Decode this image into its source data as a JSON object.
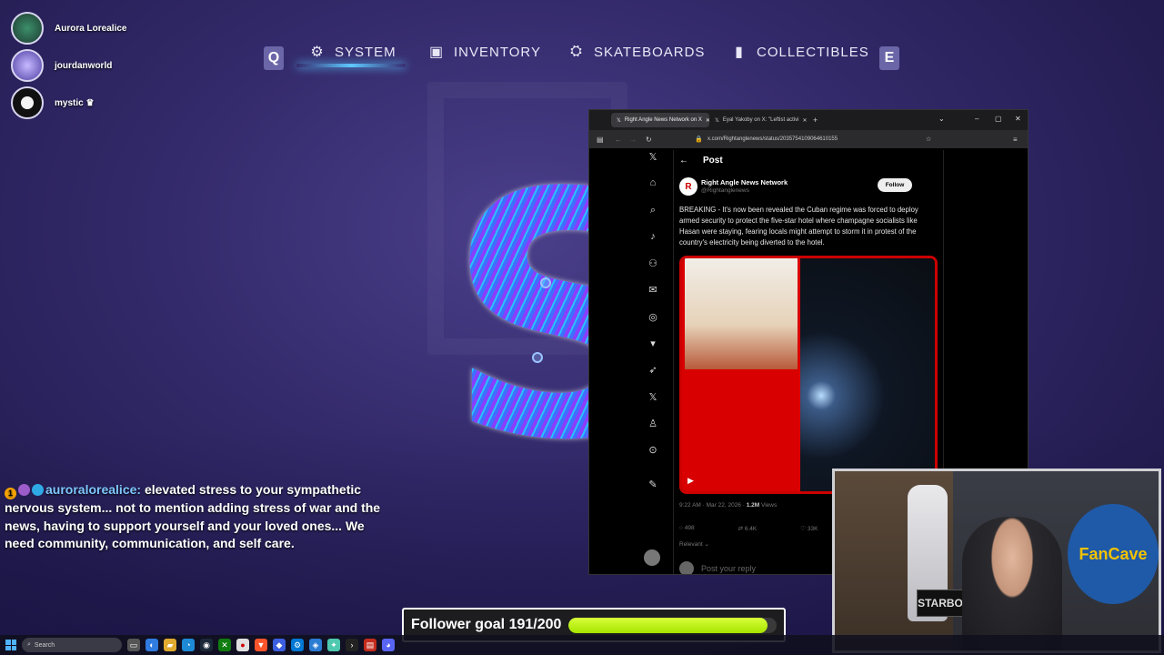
{
  "viewers": [
    {
      "name": "Aurora Lorealice"
    },
    {
      "name": "jourdanworld"
    },
    {
      "name": "mystic ♛"
    }
  ],
  "game_menu": {
    "left_key": "Q",
    "right_key": "E",
    "tabs": [
      {
        "label": "SYSTEM",
        "icon": "gear-icon",
        "active": true
      },
      {
        "label": "INVENTORY",
        "icon": "backpack-icon"
      },
      {
        "label": "SKATEBOARDS",
        "icon": "skateboard-icon"
      },
      {
        "label": "COLLECTIBLES",
        "icon": "card-icon"
      }
    ],
    "big_letter": "S"
  },
  "chat": {
    "username": "auroralorealice:",
    "message": "elevated stress to your sympathetic nervous system... not to mention adding stress of war and the news, having to support yourself and your loved ones... We need community, communication, and self care."
  },
  "browser": {
    "tabs": [
      {
        "title": "Right Angle News Network on X",
        "active": true
      },
      {
        "title": "Eyal Yakoby on X: \"Leftist activi"
      }
    ],
    "url": "x.com/Rightanglenews/status/2035754109064610155",
    "post": {
      "header": "Post",
      "author_name": "Right Angle News Network",
      "author_handle": "@Rightanglenews",
      "follow_label": "Follow",
      "text": "BREAKING - It's now been revealed the Cuban regime was forced to deploy armed security to protect the five-star hotel where champagne socialists like Hasan were staying, fearing locals might attempt to storm it in protest of the country's electricity being diverted to the hotel.",
      "time": "9:22 AM · Mar 22, 2026 ·",
      "views": "1.2M",
      "views_label": "Views",
      "replies": "498",
      "reposts": "6.4K",
      "likes": "33K",
      "sort_label": "Relevant",
      "reply_placeholder": "Post your reply"
    }
  },
  "webcam": {
    "poster_text": "FanCave",
    "sign_text": "STARBOY"
  },
  "follower_goal": {
    "label": "Follower goal 191/200",
    "current": 191,
    "target": 200
  },
  "taskbar": {
    "search_label": "Search"
  },
  "colors": {
    "goal_fill": "#b8f000",
    "accent_underline": "#5ec8ff",
    "media_border": "#cc0000"
  }
}
